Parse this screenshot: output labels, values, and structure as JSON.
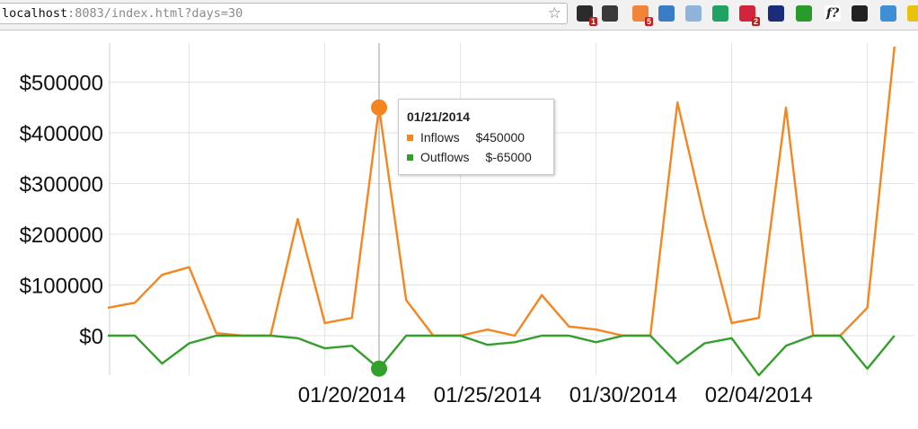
{
  "browser": {
    "url_host": "localhost",
    "url_rest": ":8083/index.html?days=30",
    "star_icon": "star-outline-icon",
    "extensions": [
      {
        "name": "ext-mail-icon",
        "color": "#2b2b2b",
        "badge": "1"
      },
      {
        "name": "ext-s-icon",
        "color": "#3a3a3a",
        "badge": ""
      },
      {
        "name": "ext-flame-icon",
        "color": "#f2843a",
        "badge": "5"
      },
      {
        "name": "ext-screenshot-icon",
        "color": "#3b7cc7",
        "badge": ""
      },
      {
        "name": "ext-window-icon",
        "color": "#8fb3d9",
        "badge": ""
      },
      {
        "name": "ext-hangouts-icon",
        "color": "#1ea362",
        "badge": ""
      },
      {
        "name": "ext-asterisk-icon",
        "color": "#d0253a",
        "badge": "2"
      },
      {
        "name": "ext-bars-icon",
        "color": "#1b2d7a",
        "badge": ""
      },
      {
        "name": "ext-timer-icon",
        "color": "#2a9a2a",
        "badge": ""
      },
      {
        "name": "ext-function-icon",
        "color": "#ffffff",
        "badge": ""
      },
      {
        "name": "ext-gear-icon",
        "color": "#222222",
        "badge": ""
      },
      {
        "name": "ext-globe-icon",
        "color": "#3f8fd6",
        "badge": ""
      },
      {
        "name": "ext-css-icon",
        "color": "#e8c20e",
        "badge": ""
      }
    ]
  },
  "chart_data": {
    "type": "line",
    "x": [
      "01/12/2014",
      "01/13/2014",
      "01/14/2014",
      "01/15/2014",
      "01/16/2014",
      "01/17/2014",
      "01/18/2014",
      "01/19/2014",
      "01/20/2014",
      "01/21/2014",
      "01/22/2014",
      "01/23/2014",
      "01/24/2014",
      "01/25/2014",
      "01/26/2014",
      "01/27/2014",
      "01/28/2014",
      "01/29/2014",
      "01/30/2014",
      "01/31/2014",
      "02/01/2014",
      "02/02/2014",
      "02/03/2014",
      "02/04/2014",
      "02/05/2014",
      "02/06/2014",
      "02/07/2014",
      "02/08/2014",
      "02/09/2014",
      "02/10/2014",
      "02/11/2014"
    ],
    "x_tick_labels": [
      "01/20/2014",
      "01/25/2014",
      "01/30/2014",
      "02/04/2014"
    ],
    "y_tick_labels": [
      "$0",
      "$100000",
      "$200000",
      "$300000",
      "$400000",
      "$500000"
    ],
    "ylim": [
      -80000,
      570000
    ],
    "grid": true,
    "series": [
      {
        "name": "Inflows",
        "color": "#f5861f",
        "values": [
          55000,
          65000,
          120000,
          135000,
          5000,
          0,
          0,
          230000,
          25000,
          35000,
          450000,
          70000,
          0,
          0,
          12000,
          0,
          80000,
          18000,
          12000,
          0,
          0,
          460000,
          230000,
          25000,
          35000,
          450000,
          0,
          0,
          55000,
          570000
        ]
      },
      {
        "name": "Outflows",
        "color": "#33a02c",
        "values": [
          0,
          0,
          -55000,
          -15000,
          0,
          0,
          0,
          -5000,
          -25000,
          -20000,
          -65000,
          0,
          0,
          0,
          -18000,
          -13000,
          0,
          0,
          -13000,
          0,
          0,
          -55000,
          -15000,
          -5000,
          -78000,
          -20000,
          0,
          0,
          -65000,
          0
        ]
      }
    ],
    "tooltip": {
      "date": "01/21/2014",
      "rows": [
        {
          "label": "Inflows",
          "value": "$450000",
          "color": "#f5861f"
        },
        {
          "label": "Outflows",
          "value": "$-65000",
          "color": "#33a02c"
        }
      ]
    }
  }
}
